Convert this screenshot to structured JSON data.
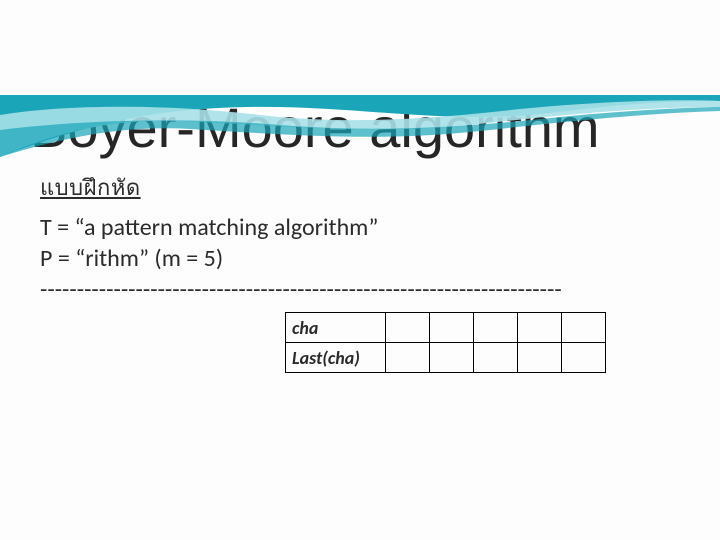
{
  "title": "Boyer-Moore algorithm",
  "exercise_label": "แบบฝึกหัด",
  "line_T": "T =  “a pattern matching algorithm”",
  "line_P": "P =  “rithm”  (m = 5)",
  "dashes": "-----------------------------------------------------------------------",
  "table": {
    "row1_header": "cha",
    "row2_header": "Last(cha)",
    "cells": [
      "",
      "",
      "",
      "",
      ""
    ]
  },
  "colors": {
    "wave_main": "#1aa5b8",
    "wave_light": "#a7e1e8"
  }
}
